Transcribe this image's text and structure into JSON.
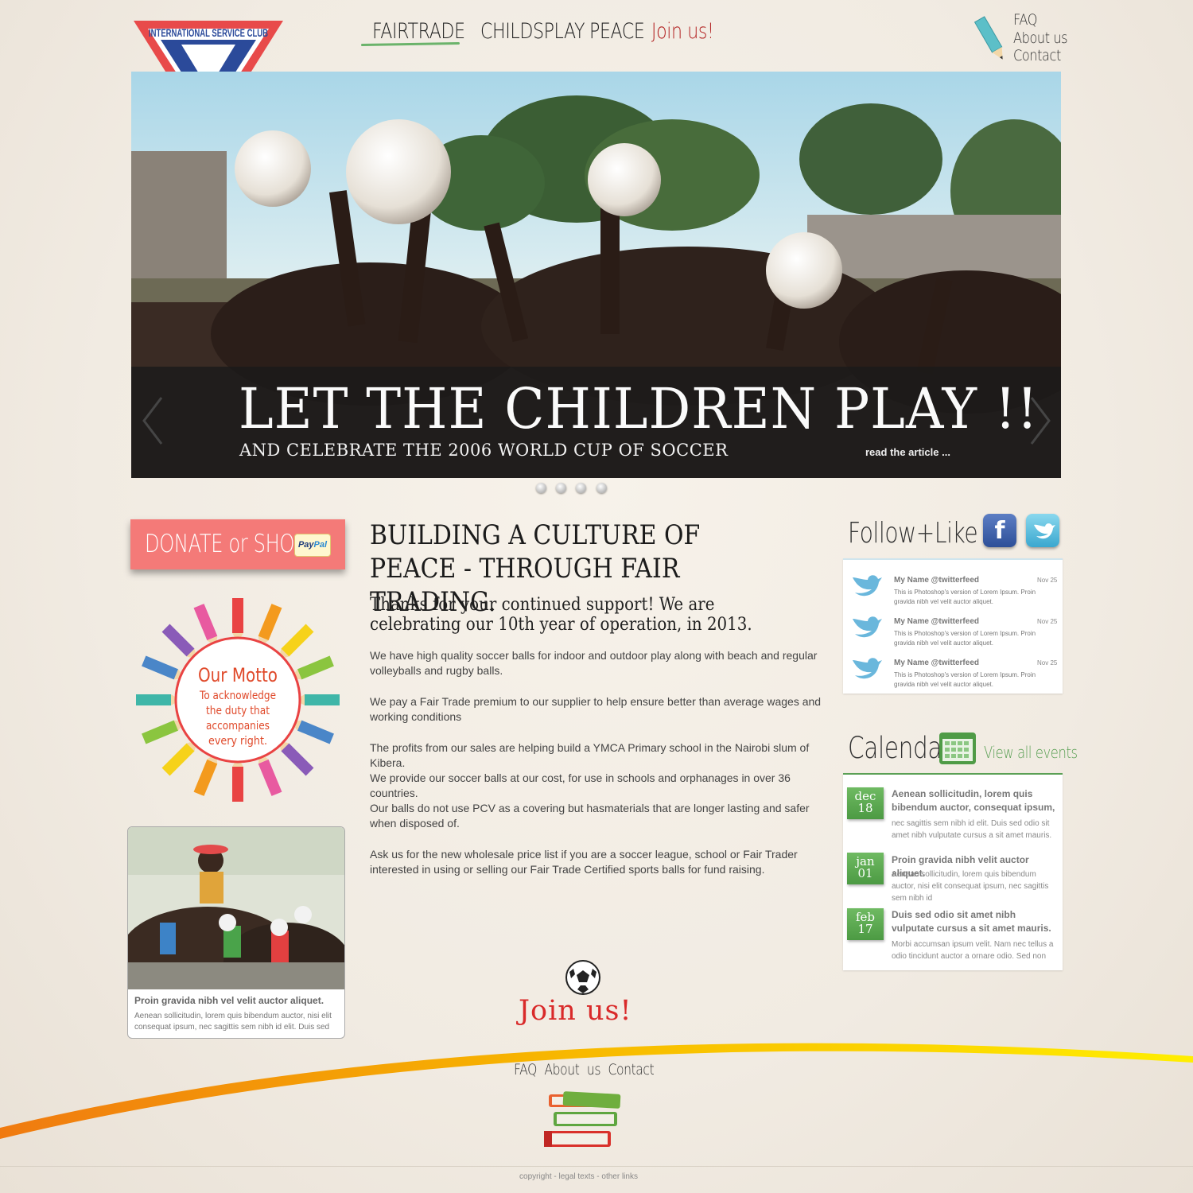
{
  "header": {
    "logo_text": "INTERNATIONAL SERVICE CLUB",
    "nav": [
      "FAIRTRADE",
      "CHILDSPLAY",
      "PEACE",
      "Join us!"
    ],
    "top_links": [
      "FAQ",
      "About us",
      "Contact"
    ]
  },
  "hero": {
    "title": "LET THE CHILDREN PLAY !!",
    "subtitle": "AND CELEBRATE THE 2006 WORLD CUP OF SOCCER",
    "read_more": "read the article ..."
  },
  "left": {
    "donate_label": "DONATE or SHOP",
    "paypal_1": "Pay",
    "paypal_2": "Pal",
    "motto_title": "Our Motto",
    "motto_lines": [
      "To acknowledge",
      "the duty that",
      "accompanies",
      "every right."
    ],
    "photo_title": "Proin gravida nibh vel velit auctor aliquet.",
    "photo_text": "Aenean sollicitudin, lorem quis bibendum auctor, nisi elit consequat ipsum, nec sagittis sem nibh id elit. Duis sed"
  },
  "main": {
    "title": "BUILDING A CULTURE OF PEACE - THROUGH FAIR TRADING.",
    "subtitle": "Thanks for your continued support!   We are celebrating our 10th year of operation, in 2013.",
    "paragraphs": [
      "We have high quality soccer balls for indoor and outdoor play along with beach and regular volleyballs and rugby balls.",
      "We pay a Fair Trade premium to our supplier to help ensure better than average wages and working conditions",
      "The profits from our sales are helping build a YMCA Primary school in the Nairobi slum of Kibera.",
      "We provide our soccer balls at our cost, for use in schools and orphanages in over 36 countries.",
      "Our balls do not use PCV as a  covering but hasmaterials that are longer lasting and safer when disposed of.",
      "Ask us for the new wholesale price list if you are a soccer league, school or Fair Trader interested in using or selling our Fair Trade Certified sports balls for fund raising."
    ],
    "join_label": "Join us!"
  },
  "social": {
    "title": "Follow+Like",
    "facebook_glyph": "f",
    "tweets": [
      {
        "name": "My Name @twitterfeed",
        "date": "Nov 25",
        "text": "This is Photoshop's version  of Lorem Ipsum. Proin gravida nibh vel velit auctor aliquet."
      },
      {
        "name": "My Name @twitterfeed",
        "date": "Nov 25",
        "text": "This is Photoshop's version  of Lorem Ipsum. Proin gravida nibh vel velit auctor aliquet."
      },
      {
        "name": "My Name @twitterfeed",
        "date": "Nov 25",
        "text": "This is Photoshop's version  of Lorem Ipsum. Proin gravida nibh vel velit auctor aliquet."
      }
    ]
  },
  "calendar": {
    "title": "Calendar",
    "view_all": "View all events",
    "events": [
      {
        "month": "dec",
        "day": "18",
        "title": "Aenean sollicitudin, lorem quis bibendum auctor, consequat ipsum,",
        "text": "nec sagittis sem nibh id elit. Duis sed odio sit amet nibh vulputate cursus a sit amet mauris."
      },
      {
        "month": "jan",
        "day": "01",
        "title": "Proin gravida nibh velit auctor aliquet.",
        "text": "Aenean sollicitudin, lorem quis bibendum auctor, nisi elit consequat ipsum, nec sagittis sem nibh id"
      },
      {
        "month": "feb",
        "day": "17",
        "title": "Duis sed odio sit amet nibh vulputate cursus a sit amet mauris.",
        "text": "Morbi accumsan ipsum velit. Nam nec tellus a odio tincidunt auctor a ornare odio. Sed non"
      }
    ]
  },
  "footer": {
    "links": [
      "FAQ",
      "About us",
      "Contact"
    ],
    "copyright": "copyright - legal texts - other links"
  },
  "colors": {
    "accent_red": "#d92a2a",
    "accent_green": "#5ba055",
    "donate_pink": "#f47a78"
  }
}
